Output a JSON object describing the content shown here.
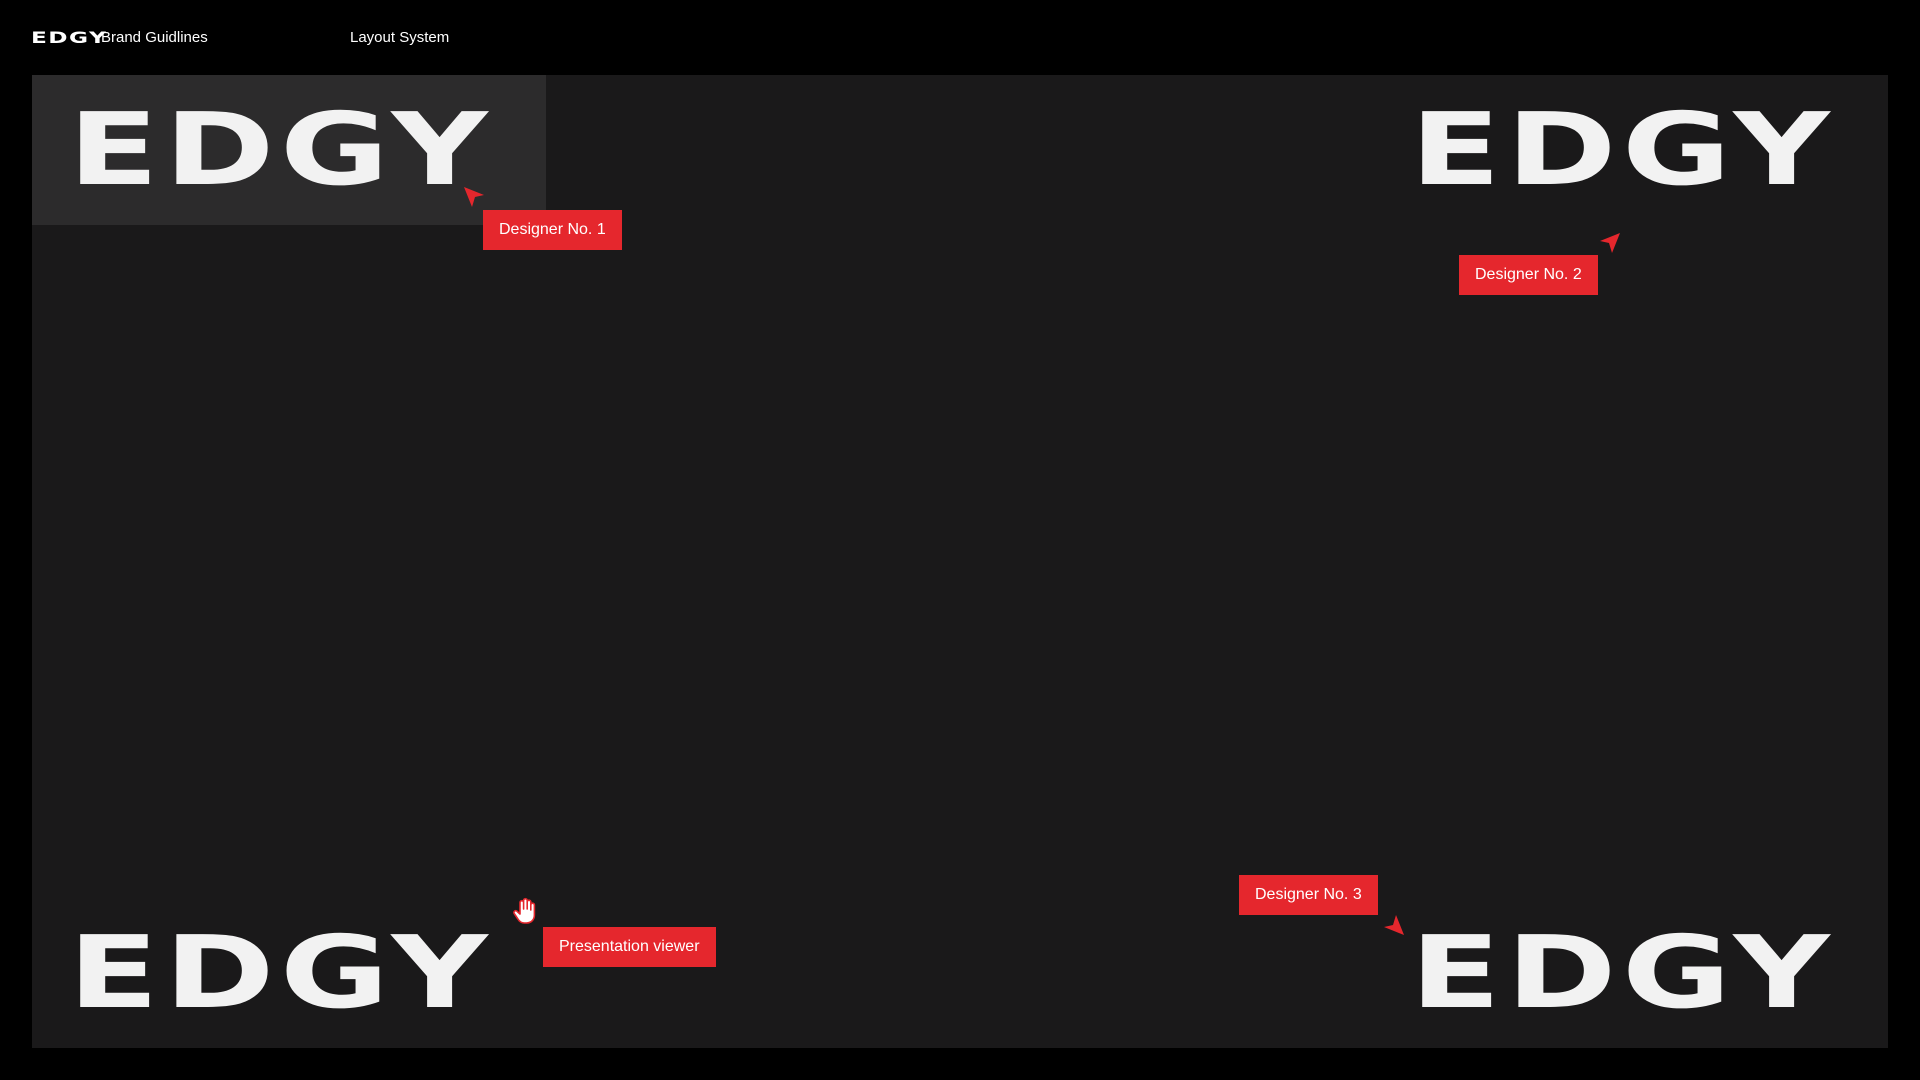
{
  "header": {
    "brand": "EDGY",
    "title": "Brand Guidlines",
    "section": "Layout System"
  },
  "canvas": {
    "logos": {
      "top_left": "EDGY",
      "top_right": "EDGY",
      "bottom_left": "EDGY",
      "bottom_right": "EDGY"
    },
    "cursors": {
      "designer_1": {
        "label": "Designer No. 1",
        "icon": "pointer-arrow-icon"
      },
      "designer_2": {
        "label": "Designer No. 2",
        "icon": "pointer-arrow-icon"
      },
      "designer_3": {
        "label": "Designer No. 3",
        "icon": "pointer-arrow-icon"
      },
      "viewer": {
        "label": "Presentation viewer",
        "icon": "hand-cursor-icon"
      }
    }
  },
  "colors": {
    "background": "#000000",
    "canvas": "#1a191a",
    "highlight": "#2c2b2c",
    "accent": "#e5272d",
    "logo": "#f2f2f2"
  }
}
